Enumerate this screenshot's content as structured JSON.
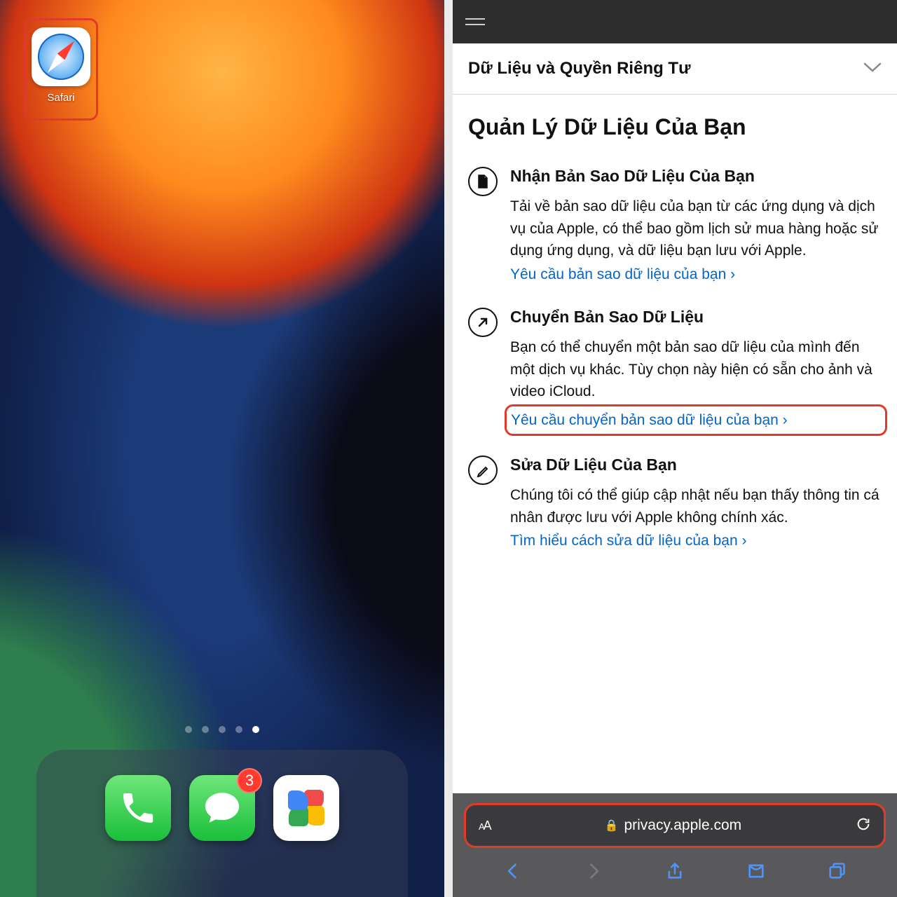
{
  "left": {
    "safari_app_label": "Safari",
    "messages_badge": "3",
    "active_page_index": 4,
    "page_count": 5,
    "dock_apps": [
      "phone",
      "messages",
      "photos"
    ]
  },
  "right": {
    "dropdown_title": "Dữ Liệu và Quyền Riêng Tư",
    "page_heading": "Quản Lý Dữ Liệu Của Bạn",
    "sections": [
      {
        "title": "Nhận Bản Sao Dữ Liệu Của Bạn",
        "body": "Tải về bản sao dữ liệu của bạn từ các ứng dụng và dịch vụ của Apple, có thể bao gồm lịch sử mua hàng hoặc sử dụng ứng dụng, và dữ liệu bạn lưu với Apple.",
        "link": "Yêu cầu bản sao dữ liệu của bạn ›"
      },
      {
        "title": "Chuyển Bản Sao Dữ Liệu",
        "body": "Bạn có thể chuyển một bản sao dữ liệu của mình đến một dịch vụ khác. Tùy chọn này hiện có sẵn cho ảnh và video iCloud.",
        "link": "Yêu cầu chuyển bản sao dữ liệu của bạn ›"
      },
      {
        "title": "Sửa Dữ Liệu Của Bạn",
        "body": "Chúng tôi có thể giúp cập nhật nếu bạn thấy thông tin cá nhân được lưu với Apple không chính xác.",
        "link": "Tìm hiểu cách sửa dữ liệu của bạn ›"
      }
    ],
    "url": "privacy.apple.com"
  }
}
